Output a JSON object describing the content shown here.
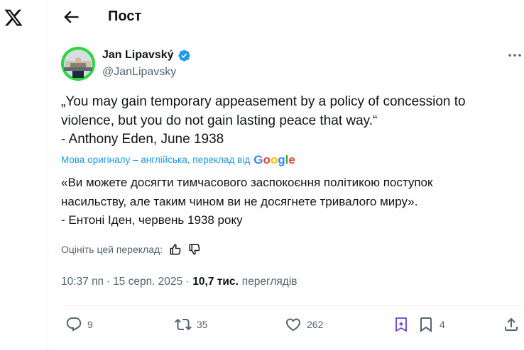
{
  "header": {
    "title": "Пост"
  },
  "tweet": {
    "author_name": "Jan Lipavský",
    "author_handle": "@JanLipavsky",
    "original_lines": [
      "„You may gain temporary appeasement by a policy of concession to",
      "violence, but you do not gain lasting peace that way.“",
      "- Anthony Eden, June 1938"
    ],
    "translation_note": "Мова оригіналу – англійська, переклад від",
    "translation_provider": "Google",
    "translated_lines": [
      "«Ви можете досягти тимчасового заспокоєння політикою поступок",
      "насильству, але таким чином ви не досягнете тривалого миру».",
      "- Ентоні Іден, червень 1938 року"
    ],
    "rate_prompt": "Оцініть цей переклад:",
    "time": "10:37 пп",
    "separator": "·",
    "date": "15 серп. 2025",
    "views_count": "10,7 тис.",
    "views_label": "переглядів"
  },
  "actions": {
    "replies": "9",
    "reposts": "35",
    "likes": "262",
    "bookmarks": "4"
  },
  "colors": {
    "accent": "#1d9bf0",
    "text": "#0f1419",
    "secondary": "#536471",
    "grok_purple": "#6b3fd1",
    "avatar_ring": "#2bd641"
  },
  "icons": [
    "x-logo-icon",
    "back-arrow-icon",
    "verified-badge-icon",
    "more-icon",
    "thumbs-up-icon",
    "thumbs-down-icon",
    "reply-icon",
    "repost-icon",
    "like-icon",
    "grok-icon",
    "bookmark-icon",
    "share-icon"
  ]
}
